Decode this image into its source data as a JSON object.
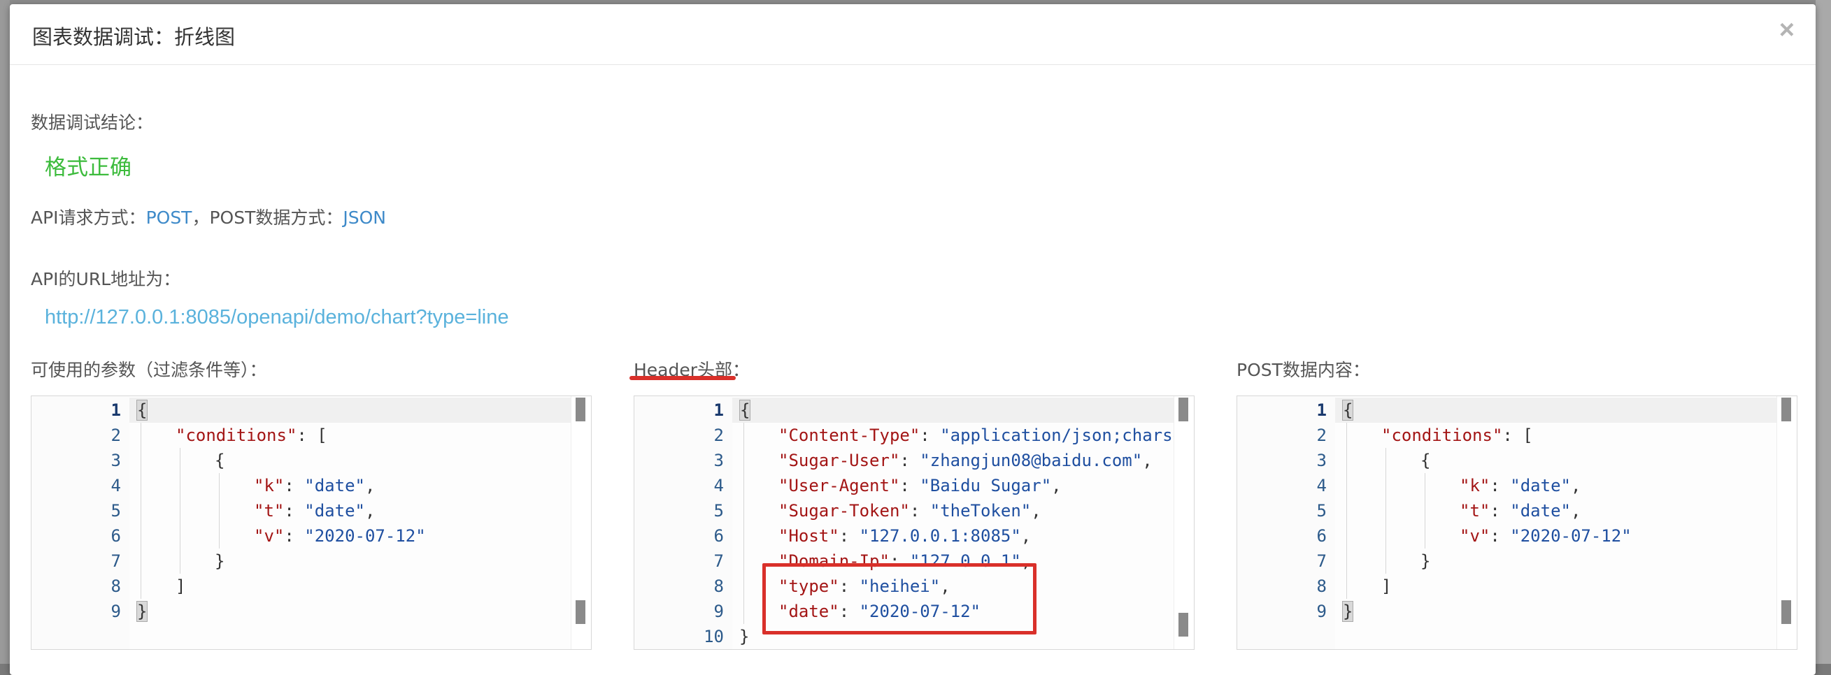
{
  "modal": {
    "title": "图表数据调试：折线图",
    "close_label": "×"
  },
  "result": {
    "label": "数据调试结论：",
    "status": "格式正确"
  },
  "api": {
    "method_label": "API请求方式：",
    "method": "POST",
    "sep": "，",
    "post_type_label": "POST数据方式：",
    "post_type": "JSON",
    "url_label": "API的URL地址为：",
    "url": "http://127.0.0.1:8085/openapi/demo/chart?type=line"
  },
  "panels": {
    "params_label": "可使用的参数（过滤条件等）：",
    "header_label": "Header头部",
    "header_colon": "：",
    "post_label": "POST数据内容："
  },
  "editors": {
    "params": {
      "line_numbers": [
        "1",
        "2",
        "3",
        "4",
        "5",
        "6",
        "7",
        "8",
        "9"
      ],
      "lines": [
        {
          "indent": 0,
          "tokens": [
            {
              "t": "p",
              "v": "{"
            }
          ]
        },
        {
          "indent": 1,
          "tokens": [
            {
              "t": "k",
              "v": "\"conditions\""
            },
            {
              "t": "p",
              "v": ": ["
            }
          ]
        },
        {
          "indent": 2,
          "tokens": [
            {
              "t": "p",
              "v": "{"
            }
          ]
        },
        {
          "indent": 3,
          "tokens": [
            {
              "t": "k",
              "v": "\"k\""
            },
            {
              "t": "p",
              "v": ": "
            },
            {
              "t": "s",
              "v": "\"date\""
            },
            {
              "t": "p",
              "v": ","
            }
          ]
        },
        {
          "indent": 3,
          "tokens": [
            {
              "t": "k",
              "v": "\"t\""
            },
            {
              "t": "p",
              "v": ": "
            },
            {
              "t": "s",
              "v": "\"date\""
            },
            {
              "t": "p",
              "v": ","
            }
          ]
        },
        {
          "indent": 3,
          "tokens": [
            {
              "t": "k",
              "v": "\"v\""
            },
            {
              "t": "p",
              "v": ": "
            },
            {
              "t": "s",
              "v": "\"2020-07-12\""
            }
          ]
        },
        {
          "indent": 2,
          "tokens": [
            {
              "t": "p",
              "v": "}"
            }
          ]
        },
        {
          "indent": 1,
          "tokens": [
            {
              "t": "p",
              "v": "]"
            }
          ]
        },
        {
          "indent": 0,
          "tokens": [
            {
              "t": "p",
              "v": "}"
            }
          ]
        }
      ]
    },
    "header": {
      "line_numbers": [
        "1",
        "2",
        "3",
        "4",
        "5",
        "6",
        "7",
        "8",
        "9",
        "10"
      ],
      "lines": [
        {
          "indent": 0,
          "tokens": [
            {
              "t": "p",
              "v": "{"
            }
          ]
        },
        {
          "indent": 1,
          "tokens": [
            {
              "t": "k",
              "v": "\"Content-Type\""
            },
            {
              "t": "p",
              "v": ": "
            },
            {
              "t": "s",
              "v": "\"application/json;charset="
            }
          ]
        },
        {
          "indent": 1,
          "tokens": [
            {
              "t": "k",
              "v": "\"Sugar-User\""
            },
            {
              "t": "p",
              "v": ": "
            },
            {
              "t": "s",
              "v": "\"zhangjun08@baidu.com\""
            },
            {
              "t": "p",
              "v": ","
            }
          ]
        },
        {
          "indent": 1,
          "tokens": [
            {
              "t": "k",
              "v": "\"User-Agent\""
            },
            {
              "t": "p",
              "v": ": "
            },
            {
              "t": "s",
              "v": "\"Baidu Sugar\""
            },
            {
              "t": "p",
              "v": ","
            }
          ]
        },
        {
          "indent": 1,
          "tokens": [
            {
              "t": "k",
              "v": "\"Sugar-Token\""
            },
            {
              "t": "p",
              "v": ": "
            },
            {
              "t": "s",
              "v": "\"theToken\""
            },
            {
              "t": "p",
              "v": ","
            }
          ]
        },
        {
          "indent": 1,
          "tokens": [
            {
              "t": "k",
              "v": "\"Host\""
            },
            {
              "t": "p",
              "v": ": "
            },
            {
              "t": "s",
              "v": "\"127.0.0.1:8085\""
            },
            {
              "t": "p",
              "v": ","
            }
          ]
        },
        {
          "indent": 1,
          "tokens": [
            {
              "t": "k",
              "v": "\"Domain-Ip\""
            },
            {
              "t": "p",
              "v": ": "
            },
            {
              "t": "s",
              "v": "\"127.0.0.1\""
            },
            {
              "t": "p",
              "v": ","
            }
          ]
        },
        {
          "indent": 1,
          "tokens": [
            {
              "t": "k",
              "v": "\"type\""
            },
            {
              "t": "p",
              "v": ": "
            },
            {
              "t": "s",
              "v": "\"heihei\""
            },
            {
              "t": "p",
              "v": ","
            }
          ]
        },
        {
          "indent": 1,
          "tokens": [
            {
              "t": "k",
              "v": "\"date\""
            },
            {
              "t": "p",
              "v": ": "
            },
            {
              "t": "s",
              "v": "\"2020-07-12\""
            }
          ]
        },
        {
          "indent": 0,
          "tokens": [
            {
              "t": "p",
              "v": "}"
            }
          ]
        }
      ]
    },
    "post": {
      "line_numbers": [
        "1",
        "2",
        "3",
        "4",
        "5",
        "6",
        "7",
        "8",
        "9"
      ],
      "lines": [
        {
          "indent": 0,
          "tokens": [
            {
              "t": "p",
              "v": "{"
            }
          ]
        },
        {
          "indent": 1,
          "tokens": [
            {
              "t": "k",
              "v": "\"conditions\""
            },
            {
              "t": "p",
              "v": ": ["
            }
          ]
        },
        {
          "indent": 2,
          "tokens": [
            {
              "t": "p",
              "v": "{"
            }
          ]
        },
        {
          "indent": 3,
          "tokens": [
            {
              "t": "k",
              "v": "\"k\""
            },
            {
              "t": "p",
              "v": ": "
            },
            {
              "t": "s",
              "v": "\"date\""
            },
            {
              "t": "p",
              "v": ","
            }
          ]
        },
        {
          "indent": 3,
          "tokens": [
            {
              "t": "k",
              "v": "\"t\""
            },
            {
              "t": "p",
              "v": ": "
            },
            {
              "t": "s",
              "v": "\"date\""
            },
            {
              "t": "p",
              "v": ","
            }
          ]
        },
        {
          "indent": 3,
          "tokens": [
            {
              "t": "k",
              "v": "\"v\""
            },
            {
              "t": "p",
              "v": ": "
            },
            {
              "t": "s",
              "v": "\"2020-07-12\""
            }
          ]
        },
        {
          "indent": 2,
          "tokens": [
            {
              "t": "p",
              "v": "}"
            }
          ]
        },
        {
          "indent": 1,
          "tokens": [
            {
              "t": "p",
              "v": "]"
            }
          ]
        },
        {
          "indent": 0,
          "tokens": [
            {
              "t": "p",
              "v": "}"
            }
          ]
        }
      ]
    }
  },
  "colors": {
    "success": "#3cbb3c",
    "link": "#3e8ac9",
    "url": "#5ab2dc",
    "json_key": "#a31515",
    "json_string": "#1f4fa0",
    "annotation_red": "#d9302a"
  }
}
